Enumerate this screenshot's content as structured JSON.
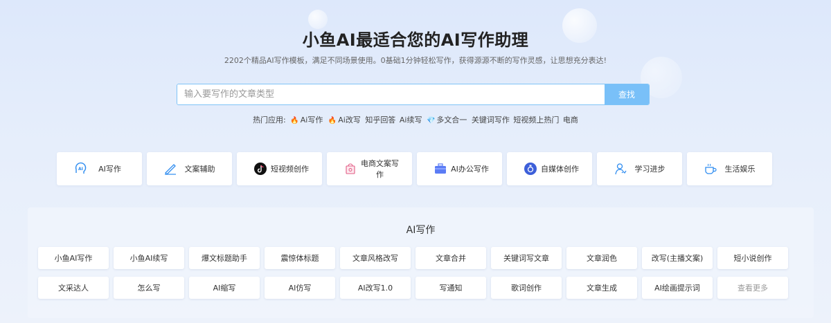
{
  "header": {
    "title": "小鱼AI最适合您的AI写作助理",
    "subtitle": "2202个精品AI写作模板，满足不同场景使用。0基础1分钟轻松写作，获得源源不断的写作灵感，让思想充分表达!"
  },
  "search": {
    "placeholder": "输入要写作的文章类型",
    "value": "",
    "button_label": "查找"
  },
  "hot": {
    "label": "热门应用:",
    "items": [
      {
        "icon": "fire",
        "label": "Ai写作"
      },
      {
        "icon": "fire",
        "label": "Ai改写"
      },
      {
        "icon": "",
        "label": "知乎回答"
      },
      {
        "icon": "",
        "label": "Ai续写"
      },
      {
        "icon": "diamond",
        "label": "多文合一"
      },
      {
        "icon": "",
        "label": "关键词写作"
      },
      {
        "icon": "",
        "label": "短视频上热门"
      },
      {
        "icon": "",
        "label": "电商"
      }
    ]
  },
  "categories": [
    {
      "icon": "ai-head-icon",
      "label": "AI写作"
    },
    {
      "icon": "pen-icon",
      "label": "文案辅助"
    },
    {
      "icon": "tiktok-icon",
      "label": "短视频创作"
    },
    {
      "icon": "shop-icon",
      "label": "电商文案写作"
    },
    {
      "icon": "briefcase-icon",
      "label": "AI办公写作"
    },
    {
      "icon": "media-icon",
      "label": "自媒体创作"
    },
    {
      "icon": "person-icon",
      "label": "学习进步"
    },
    {
      "icon": "cup-icon",
      "label": "生活娱乐"
    }
  ],
  "section": {
    "title": "AI写作",
    "tools": [
      "小鱼AI写作",
      "小鱼AI续写",
      "爆文标题助手",
      "震惊体标题",
      "文章风格改写",
      "文章合并",
      "关键词写文章",
      "文章润色",
      "改写(主播文案)",
      "短小说创作",
      "文采达人",
      "怎么写",
      "AI缩写",
      "AI仿写",
      "AI改写1.0",
      "写通知",
      "歌词创作",
      "文章生成",
      "AI绘画提示词",
      "查看更多"
    ]
  },
  "colors": {
    "accent": "#79c0f8",
    "search_border": "#7ec3f7",
    "background_top": "#dde8fb"
  }
}
